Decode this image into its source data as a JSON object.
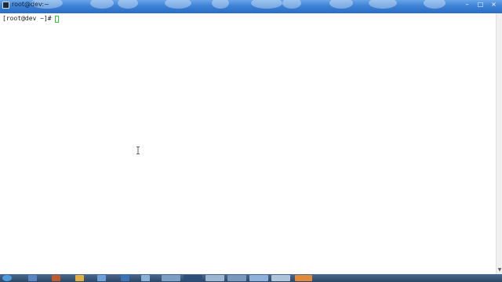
{
  "window": {
    "title": "root@dev:~",
    "controls": [
      "–",
      "□",
      "×"
    ]
  },
  "terminal": {
    "prompt": "[root@dev ~]#"
  },
  "icons": {
    "app": "terminal-icon",
    "cursor": "text-cursor-icon",
    "mouse": "ibeam-cursor-icon",
    "scroll_down": "chevron-down-icon"
  },
  "colors": {
    "titlebar": "#3d82d6",
    "terminal_bg": "#ffffff",
    "terminal_fg": "#1a1a1a",
    "cursor": "#35c435",
    "taskbar": "#2c4766"
  }
}
